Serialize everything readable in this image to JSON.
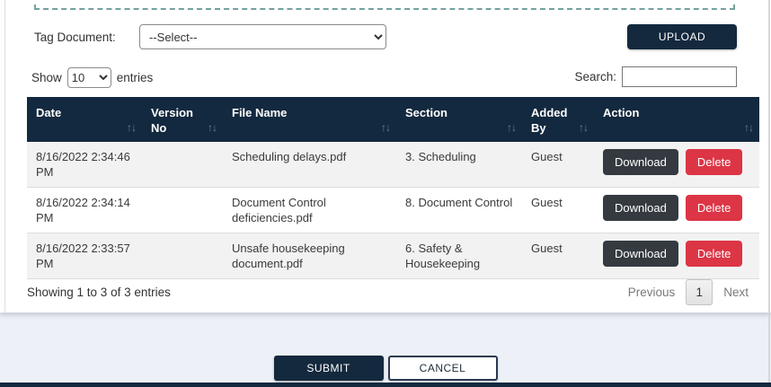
{
  "upload_panel": {
    "tag_label": "Tag Document:",
    "tag_select": {
      "options": [
        "--Select--"
      ],
      "value": "--Select--"
    },
    "upload_button": "UPLOAD"
  },
  "table_controls": {
    "show_prefix": "Show",
    "show_select": {
      "options": [
        "10"
      ],
      "value": "10"
    },
    "show_suffix": "entries",
    "search_label": "Search:",
    "search_value": ""
  },
  "table": {
    "columns": [
      "Date",
      "Version No",
      "File Name",
      "Section",
      "Added By",
      "Action"
    ],
    "sort_icon": "↑↓",
    "download_label": "Download",
    "delete_label": "Delete",
    "rows": [
      {
        "date": "8/16/2022 2:34:46 PM",
        "version_no": "",
        "file_name": "Scheduling delays.pdf",
        "section": "3. Scheduling",
        "added_by": "Guest"
      },
      {
        "date": "8/16/2022 2:34:14 PM",
        "version_no": "",
        "file_name": "Document Control deficiencies.pdf",
        "section": "8. Document Control",
        "added_by": "Guest"
      },
      {
        "date": "8/16/2022 2:33:57 PM",
        "version_no": "",
        "file_name": "Unsafe housekeeping document.pdf",
        "section": "6. Safety & Housekeeping",
        "added_by": "Guest"
      }
    ]
  },
  "table_footer": {
    "info": "Showing 1 to 3 of 3 entries",
    "previous_label": "Previous",
    "current_page": "1",
    "next_label": "Next"
  },
  "actions": {
    "submit_label": "SUBMIT",
    "cancel_label": "CANCEL"
  },
  "colors": {
    "navy": "#14293e",
    "table_header_bg": "#13293f",
    "download_dark": "#343a40",
    "delete_red": "#dc3545",
    "row_stripe": "#f2f2f2",
    "dropzone_dash": "#74a29e",
    "page_background": "#edf1f7"
  }
}
